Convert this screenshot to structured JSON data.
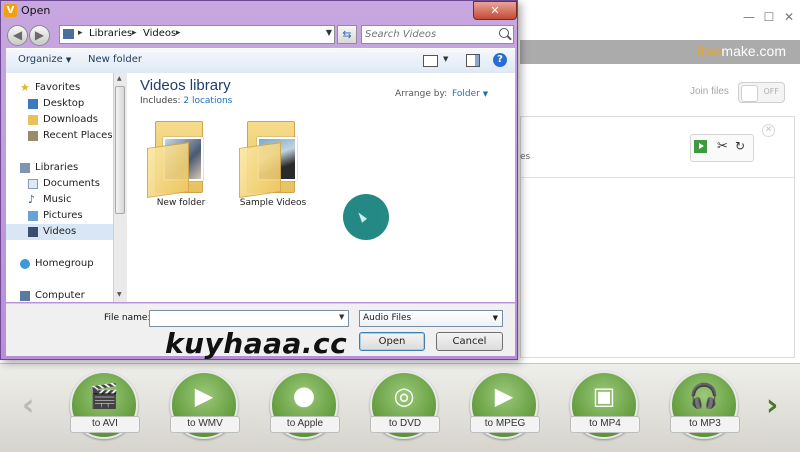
{
  "app": {
    "brand_part1": "free",
    "brand_part2": "make.com",
    "join_files_label": "Join files",
    "toggle_state": "OFF",
    "file_fragment": "es",
    "convert_buttons": [
      {
        "label": "to AVI",
        "icon": "film-clapper-icon"
      },
      {
        "label": "to WMV",
        "icon": "wmv-play-icon"
      },
      {
        "label": "to Apple",
        "icon": "apple-icon"
      },
      {
        "label": "to DVD",
        "icon": "dvd-disc-icon"
      },
      {
        "label": "to MPEG",
        "icon": "mpeg-tv-icon"
      },
      {
        "label": "to MP4",
        "icon": "mp4-player-icon"
      },
      {
        "label": "to MP3",
        "icon": "headphones-icon"
      }
    ],
    "colors": {
      "brand_orange": "#f0a21a",
      "button_green": "#5f9a3a",
      "arrow_green": "#4b7a2e"
    }
  },
  "dialog": {
    "title": "Open",
    "breadcrumb": [
      "Libraries",
      "Videos"
    ],
    "search_placeholder": "Search Videos",
    "commands": {
      "organize": "Organize",
      "new_folder": "New folder"
    },
    "nav": {
      "favorites": "Favorites",
      "favorites_items": [
        "Desktop",
        "Downloads",
        "Recent Places"
      ],
      "libraries": "Libraries",
      "libraries_items": [
        "Documents",
        "Music",
        "Pictures",
        "Videos"
      ],
      "selected": "Videos",
      "homegroup": "Homegroup",
      "computer": "Computer"
    },
    "library": {
      "title": "Videos library",
      "includes_label": "Includes:",
      "includes_link": "2 locations",
      "arrange_label": "Arrange by:",
      "arrange_value": "Folder"
    },
    "folders": [
      {
        "name": "New folder"
      },
      {
        "name": "Sample Videos"
      }
    ],
    "file_name_label": "File name:",
    "file_name_value": "",
    "file_type": "Audio Files",
    "open_label": "Open",
    "cancel_label": "Cancel"
  },
  "watermark": "kuyhaaa.cc"
}
